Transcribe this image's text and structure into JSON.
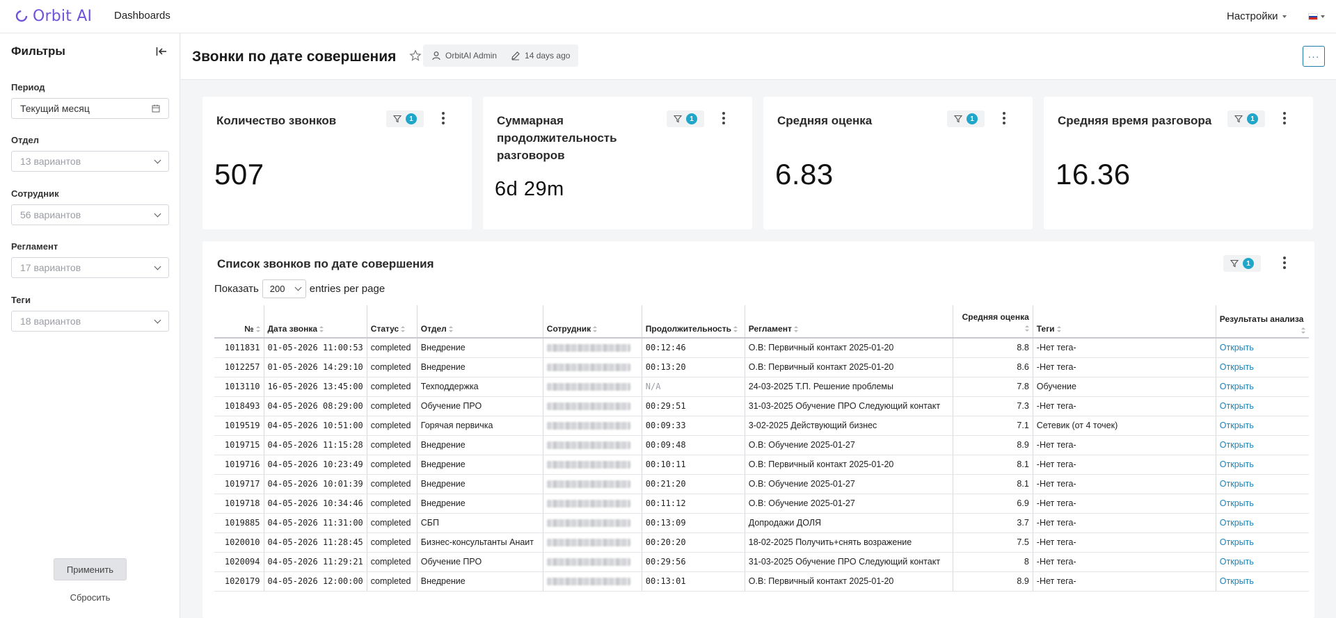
{
  "nav": {
    "logo": "Orbit AI",
    "dashboards": "Dashboards",
    "settings": "Настройки",
    "brand_color": "#6f53d8"
  },
  "sidebar": {
    "title": "Фильтры",
    "filters": [
      {
        "label": "Период",
        "value": "Текущий месяц",
        "is_placeholder": false,
        "icon": "calendar-icon"
      },
      {
        "label": "Отдел",
        "value": "13 вариантов",
        "is_placeholder": true,
        "icon": "chevron-down-icon"
      },
      {
        "label": "Сотрудник",
        "value": "56 вариантов",
        "is_placeholder": true,
        "icon": "chevron-down-icon"
      },
      {
        "label": "Регламент",
        "value": "17 вариантов",
        "is_placeholder": true,
        "icon": "chevron-down-icon"
      },
      {
        "label": "Теги",
        "value": "18 вариантов",
        "is_placeholder": true,
        "icon": "chevron-down-icon"
      }
    ],
    "apply": "Применить",
    "reset": "Сбросить"
  },
  "header": {
    "title": "Звонки по дате совершения",
    "owner": "OrbitAI Admin",
    "modified": "14 days ago"
  },
  "cards": [
    {
      "title": "Количество звонков",
      "value": "507",
      "filter_count": "1"
    },
    {
      "title": "Суммарная продолжительность разговоров",
      "value": "6d 29m",
      "filter_count": "1"
    },
    {
      "title": "Средняя оценка",
      "value": "6.83",
      "filter_count": "1"
    },
    {
      "title": "Средняя время разговора",
      "value": "16.36",
      "filter_count": "1"
    }
  ],
  "table_panel": {
    "title": "Список звонков по дате совершения",
    "filter_count": "1",
    "show_label": "Показать",
    "per_page": "200",
    "per_page_suffix": "entries per page",
    "columns": [
      "№",
      "Дата звонка",
      "Статус",
      "Отдел",
      "Сотрудник",
      "Продолжительность",
      "Регламент",
      "Средняя оценка",
      "Теги",
      "Результаты анализа"
    ],
    "rows": [
      {
        "id": "1011831",
        "date": "01-05-2026 11:00:53",
        "status": "completed",
        "dept": "Внедрение",
        "duration": "00:12:46",
        "reglament": "О.В: Первичный контакт 2025-01-20",
        "score": "8.8",
        "tags": "-Нет тега-",
        "result": "Открыть"
      },
      {
        "id": "1012257",
        "date": "01-05-2026 14:29:10",
        "status": "completed",
        "dept": "Внедрение",
        "duration": "00:13:20",
        "reglament": "О.В: Первичный контакт 2025-01-20",
        "score": "8.6",
        "tags": "-Нет тега-",
        "result": "Открыть"
      },
      {
        "id": "1013110",
        "date": "16-05-2026 13:45:00",
        "status": "completed",
        "dept": "Техподдержка",
        "duration": "N/A",
        "reglament": "24-03-2025 Т.П. Решение проблемы",
        "score": "7.8",
        "tags": "Обучение",
        "result": "Открыть"
      },
      {
        "id": "1018493",
        "date": "04-05-2026 08:29:00",
        "status": "completed",
        "dept": "Обучение ПРО",
        "duration": "00:29:51",
        "reglament": "31-03-2025 Обучение ПРО Следующий контакт",
        "score": "7.3",
        "tags": "-Нет тега-",
        "result": "Открыть"
      },
      {
        "id": "1019519",
        "date": "04-05-2026 10:51:00",
        "status": "completed",
        "dept": "Горячая первичка",
        "duration": "00:09:33",
        "reglament": "3-02-2025 Действующий бизнес",
        "score": "7.1",
        "tags": "Сетевик (от 4 точек)",
        "result": "Открыть"
      },
      {
        "id": "1019715",
        "date": "04-05-2026 11:15:28",
        "status": "completed",
        "dept": "Внедрение",
        "duration": "00:09:48",
        "reglament": "О.В: Обучение 2025-01-27",
        "score": "8.9",
        "tags": "-Нет тега-",
        "result": "Открыть"
      },
      {
        "id": "1019716",
        "date": "04-05-2026 10:23:49",
        "status": "completed",
        "dept": "Внедрение",
        "duration": "00:10:11",
        "reglament": "О.В: Первичный контакт 2025-01-20",
        "score": "8.1",
        "tags": "-Нет тега-",
        "result": "Открыть"
      },
      {
        "id": "1019717",
        "date": "04-05-2026 10:01:39",
        "status": "completed",
        "dept": "Внедрение",
        "duration": "00:21:20",
        "reglament": "О.В: Обучение 2025-01-27",
        "score": "8.1",
        "tags": "-Нет тега-",
        "result": "Открыть"
      },
      {
        "id": "1019718",
        "date": "04-05-2026 10:34:46",
        "status": "completed",
        "dept": "Внедрение",
        "duration": "00:11:12",
        "reglament": "О.В: Обучение 2025-01-27",
        "score": "6.9",
        "tags": "-Нет тега-",
        "result": "Открыть"
      },
      {
        "id": "1019885",
        "date": "04-05-2026 11:31:00",
        "status": "completed",
        "dept": "СБП",
        "duration": "00:13:09",
        "reglament": "Допродажи ДОЛЯ",
        "score": "3.7",
        "tags": "-Нет тега-",
        "result": "Открыть"
      },
      {
        "id": "1020010",
        "date": "04-05-2026 11:28:45",
        "status": "completed",
        "dept": "Бизнес-консультанты Анаит",
        "duration": "00:20:20",
        "reglament": "18-02-2025 Получить+снять возражение",
        "score": "7.5",
        "tags": "-Нет тега-",
        "result": "Открыть"
      },
      {
        "id": "1020094",
        "date": "04-05-2026 11:29:21",
        "status": "completed",
        "dept": "Обучение ПРО",
        "duration": "00:29:56",
        "reglament": "31-03-2025 Обучение ПРО Следующий контакт",
        "score": "8",
        "tags": "-Нет тега-",
        "result": "Открыть"
      },
      {
        "id": "1020179",
        "date": "04-05-2026 12:00:00",
        "status": "completed",
        "dept": "Внедрение",
        "duration": "00:13:01",
        "reglament": "О.В: Первичный контакт 2025-01-20",
        "score": "8.9",
        "tags": "-Нет тега-",
        "result": "Открыть"
      }
    ]
  }
}
